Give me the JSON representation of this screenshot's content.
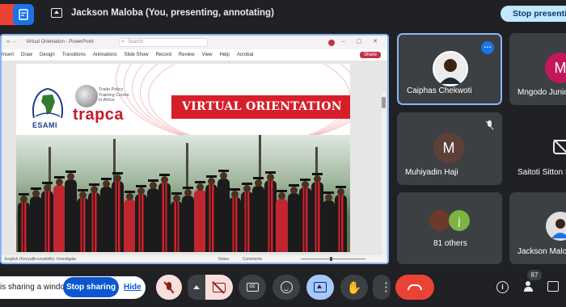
{
  "topbar": {
    "presenting_text": "Jackson Maloba (You, presenting, annotating)",
    "stop_presenting_label": "Stop presenting"
  },
  "presentation": {
    "window_title": "Virtual Orientation - PowerPoint",
    "search_placeholder": "Search",
    "ribbon_tabs": [
      "Insert",
      "Draw",
      "Design",
      "Transitions",
      "Animations",
      "Slide Show",
      "Record",
      "Review",
      "View",
      "Help",
      "Acrobat"
    ],
    "share_label": "Share",
    "status_left": "English (Kenya)",
    "status_accessibility": "Accessibility: Investigate",
    "status_notes": "Notes",
    "status_comments": "Comments",
    "slide": {
      "banner_text": "VIRTUAL ORIENTATION",
      "esami_label": "ESAMI",
      "trapca_label": "trapca",
      "trapca_tagline": "Trade Policy\nTraining Centre\nin Africa"
    }
  },
  "participants": [
    {
      "name": "Caiphas Chekwoti",
      "avatar_type": "photo",
      "active": true
    },
    {
      "name": "Mngodo Junior",
      "initial": "M",
      "avatar_color": "#c2185b"
    },
    {
      "name": "Muhiyadin Haji",
      "initial": "M",
      "avatar_color": "#5d4037",
      "muted": true
    },
    {
      "name": "Saitoti Sitton S",
      "camera_off": true
    },
    {
      "name": "81 others",
      "initial": "j",
      "avatar_color": "#7cb342"
    },
    {
      "name": "Jackson Malob",
      "avatar_type": "photo"
    }
  ],
  "share_bar": {
    "message": "is sharing a window.",
    "stop_sharing_label": "Stop sharing",
    "hide_label": "Hide"
  },
  "controls": {
    "cc_text": "CC",
    "people_count": "87"
  },
  "colors": {
    "accent_blue": "#8ab4f8",
    "stop_pill": "#c2e7ff",
    "leave_red": "#ea4335",
    "banner_red": "#d61f2b"
  }
}
